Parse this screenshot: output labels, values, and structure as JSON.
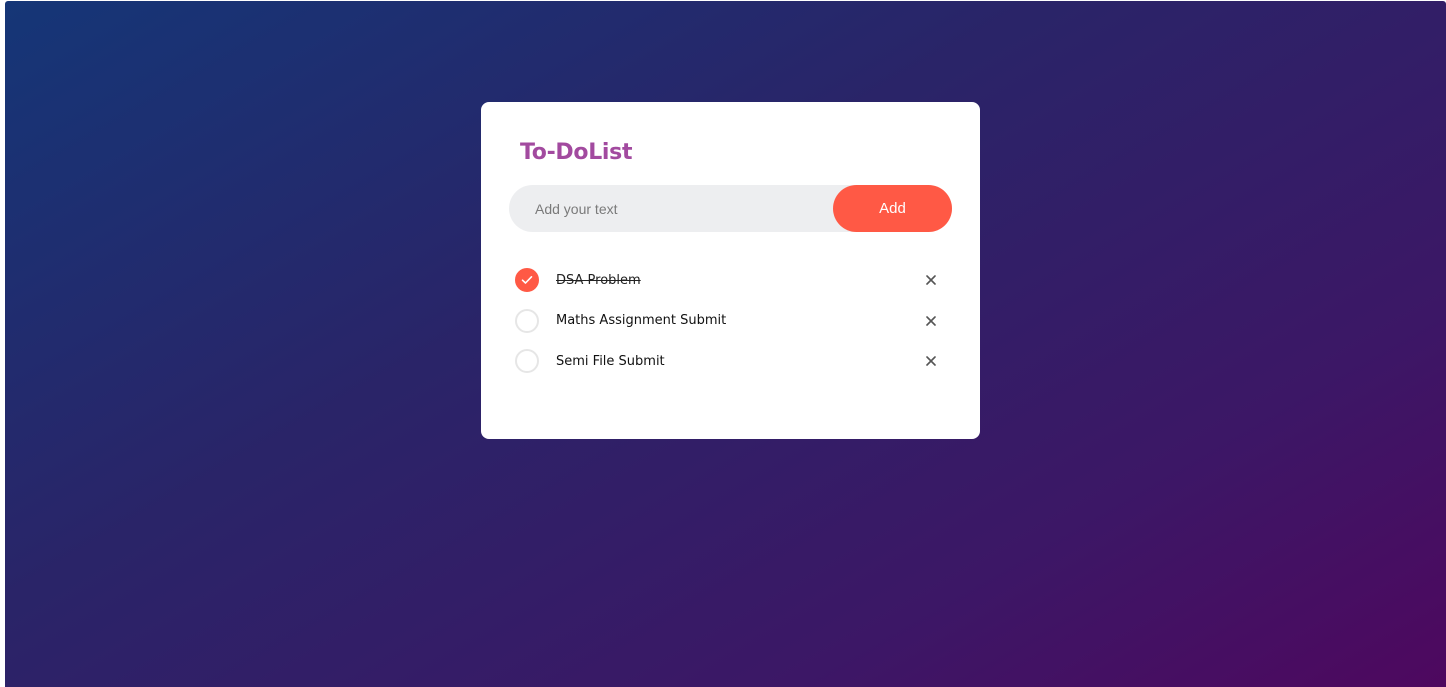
{
  "app": {
    "title": "To-DoList"
  },
  "input": {
    "placeholder": "Add your text",
    "value": ""
  },
  "add_button": {
    "label": "Add"
  },
  "tasks": [
    {
      "text": "DSA Problem",
      "completed": true
    },
    {
      "text": "Maths Assignment Submit",
      "completed": false
    },
    {
      "text": "Semi File Submit",
      "completed": false
    }
  ],
  "icons": {
    "check": "check-icon",
    "delete": "close-icon"
  },
  "colors": {
    "accent": "#ff5945",
    "title": "#a24a9f",
    "background_start": "#153677",
    "background_end": "#4e085f",
    "input_bg": "#edeef0"
  }
}
